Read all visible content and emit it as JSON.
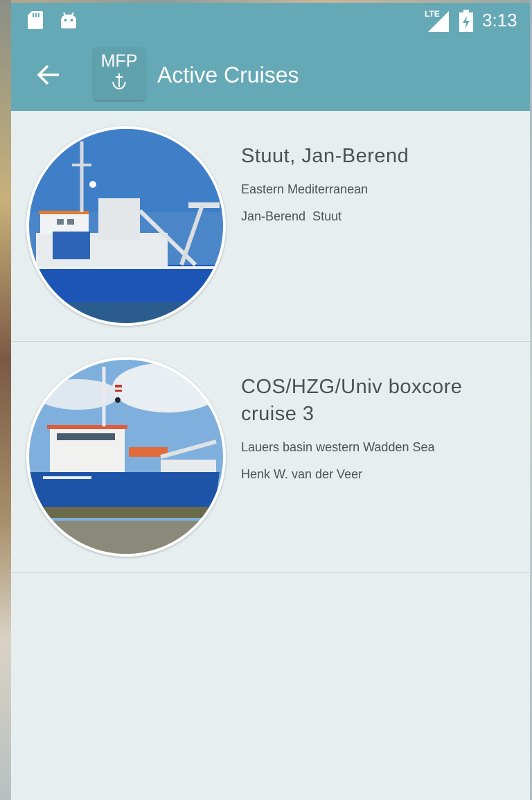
{
  "status_bar": {
    "time": "3:13",
    "network": "LTE",
    "icons": [
      "sd-card-icon",
      "android-icon",
      "signal-icon",
      "battery-icon"
    ]
  },
  "app_bar": {
    "back_icon": "arrow-left-icon",
    "logo_text": "MFP",
    "title": "Active Cruises"
  },
  "cruises": [
    {
      "name": "Stuut, Jan-Berend",
      "region": "Eastern Mediterranean",
      "person": "Jan-Berend  Stuut",
      "image": "research-vessel-photo"
    },
    {
      "name": "COS/HZG/Univ boxcore cruise 3",
      "region": "Lauers basin western Wadden Sea",
      "person": "Henk W. van der Veer",
      "image": "research-vessel-photo"
    }
  ],
  "colors": {
    "primary": "#66a9b6",
    "background": "#e6eeef",
    "text": "#4a5153"
  }
}
